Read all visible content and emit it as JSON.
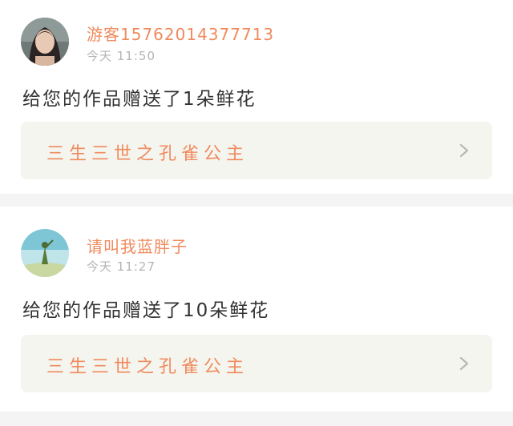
{
  "notifications": [
    {
      "user_name": "游客15762014377713",
      "time": "今天 11:50",
      "message": "给您的作品赠送了1朵鲜花",
      "work_title": "三生三世之孔雀公主",
      "avatar_icon": "portrait-avatar",
      "chevron_icon": "chevron-right-icon"
    },
    {
      "user_name": "请叫我蓝胖子",
      "time": "今天 11:27",
      "message": "给您的作品赠送了10朵鲜花",
      "work_title": "三生三世之孔雀公主",
      "avatar_icon": "landscape-avatar",
      "chevron_icon": "chevron-right-icon"
    }
  ],
  "colors": {
    "accent": "#f08a5d",
    "time": "#b5b5b5",
    "link_bg": "#f5f5ef",
    "divider": "#f4f4f4"
  }
}
